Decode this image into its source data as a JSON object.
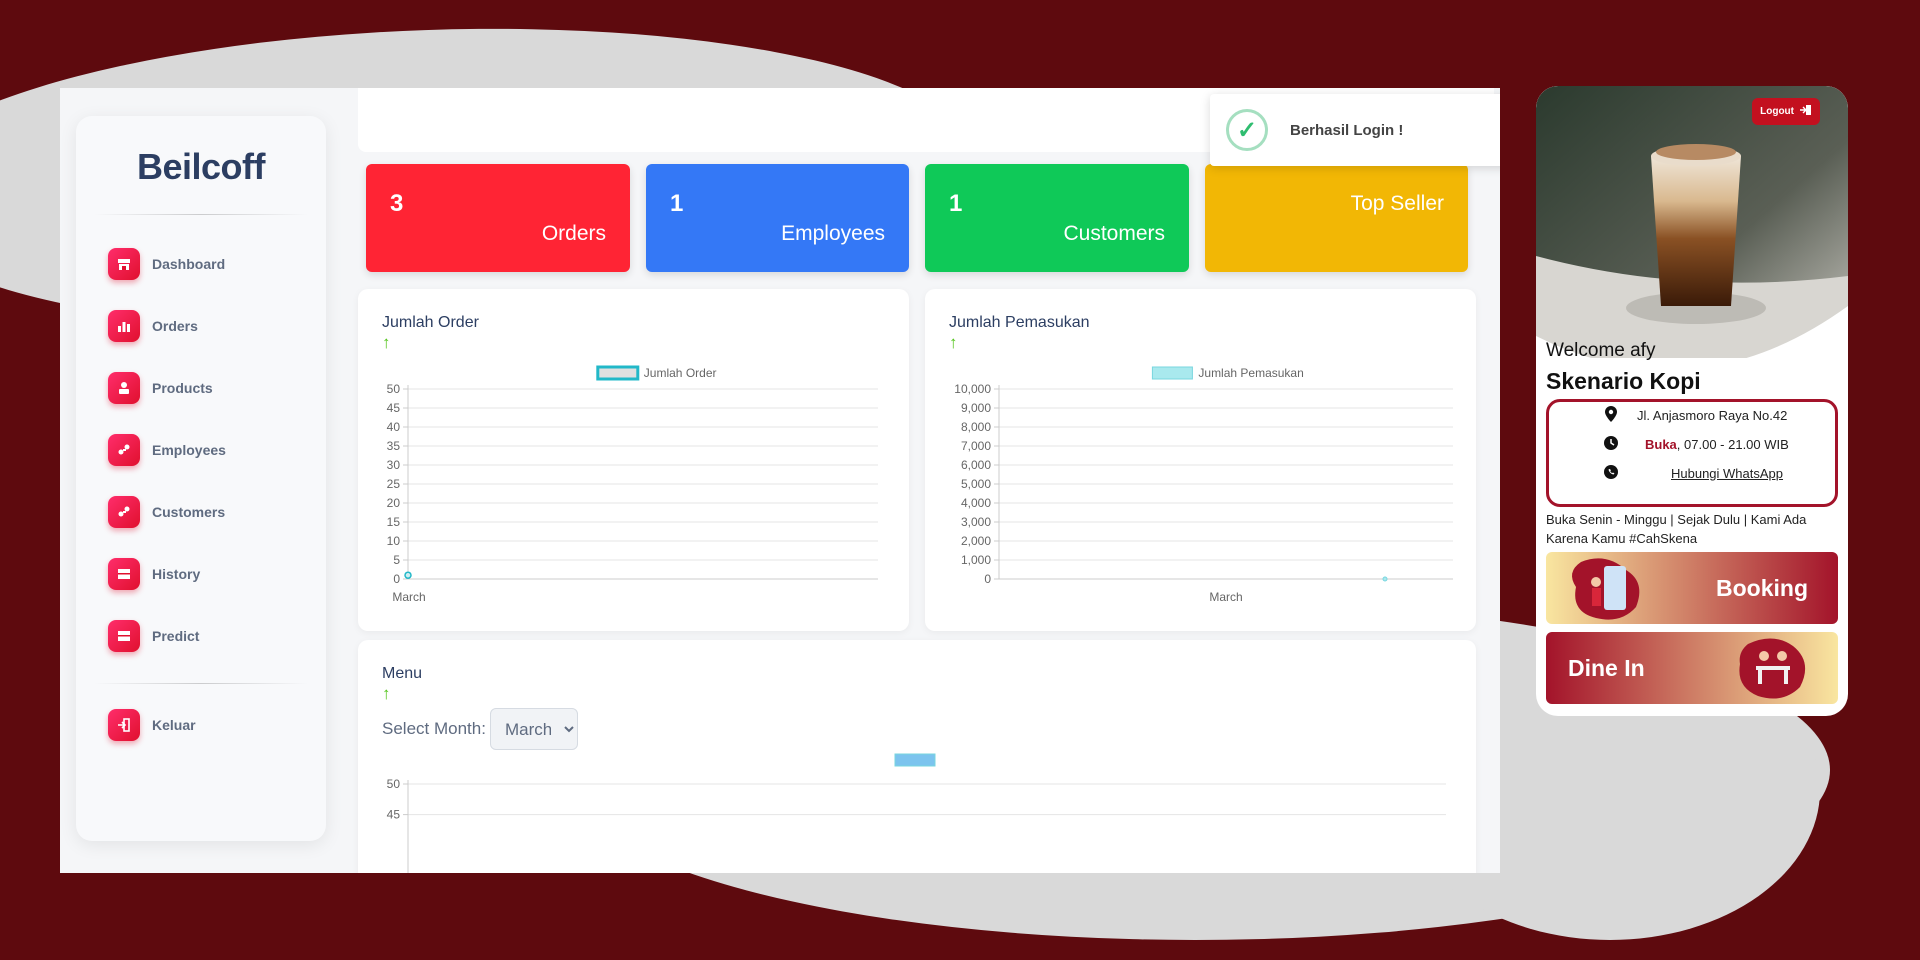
{
  "sidebar": {
    "brand": "Beilcoff",
    "items": [
      {
        "label": "Dashboard",
        "icon": "store-icon"
      },
      {
        "label": "Orders",
        "icon": "bar-chart-icon"
      },
      {
        "label": "Products",
        "icon": "box-icon"
      },
      {
        "label": "Employees",
        "icon": "users-icon"
      },
      {
        "label": "Customers",
        "icon": "users-icon"
      },
      {
        "label": "History",
        "icon": "table-icon"
      },
      {
        "label": "Predict",
        "icon": "table-icon"
      }
    ],
    "logout": {
      "label": "Keluar",
      "icon": "exit-icon"
    }
  },
  "toast": {
    "message": "Berhasil Login !"
  },
  "cards": [
    {
      "value": "3",
      "label": "Orders",
      "color": "#ff2434"
    },
    {
      "value": "1",
      "label": "Employees",
      "color": "#3478f6"
    },
    {
      "value": "1",
      "label": "Customers",
      "color": "#0fc958"
    },
    {
      "value": "",
      "label": "Top Seller",
      "color": "#f2b705"
    }
  ],
  "chart_data": [
    {
      "type": "line",
      "title": "Jumlah Order",
      "categories": [
        "March"
      ],
      "series": [
        {
          "name": "Jumlah Order",
          "values": [
            1
          ]
        }
      ],
      "ylim": [
        0,
        50
      ],
      "yticks": [
        "0",
        "5",
        "10",
        "15",
        "20",
        "25",
        "30",
        "35",
        "40",
        "45",
        "50"
      ],
      "grid": true,
      "legend": "top",
      "color": "#22b8c8"
    },
    {
      "type": "area",
      "title": "Jumlah Pemasukan",
      "categories": [
        "March"
      ],
      "series": [
        {
          "name": "Jumlah Pemasukan",
          "values": [
            0
          ]
        }
      ],
      "ylim": [
        0,
        10000
      ],
      "yticks": [
        "0",
        "1,000",
        "2,000",
        "3,000",
        "4,000",
        "5,000",
        "6,000",
        "7,000",
        "8,000",
        "9,000",
        "10,000"
      ],
      "grid": true,
      "legend": "top",
      "color": "#a9e9ee"
    },
    {
      "type": "bar",
      "title": "Menu",
      "categories": [],
      "series": [
        {
          "values": []
        }
      ],
      "ylim": [
        0,
        50
      ],
      "yticks": [
        "45",
        "50"
      ],
      "grid": true,
      "legend": "top",
      "color": "#7cc4ee"
    }
  ],
  "menu_filter": {
    "label": "Select Month:",
    "selected": "March"
  },
  "mobile": {
    "logout": "Logout",
    "welcome": "Welcome afy",
    "store_name": "Skenario Kopi",
    "address": "Jl. Anjasmoro Raya No.42",
    "status": "Buka",
    "hours": ", 07.00 - 21.00 WIB",
    "whatsapp": "Hubungi WhatsApp",
    "tagline": "Buka Senin - Minggu | Sejak Dulu | Kami Ada Karena Kamu #CahSkena",
    "booking": "Booking",
    "dine_in": "Dine In",
    "accent": "#a3132a"
  }
}
